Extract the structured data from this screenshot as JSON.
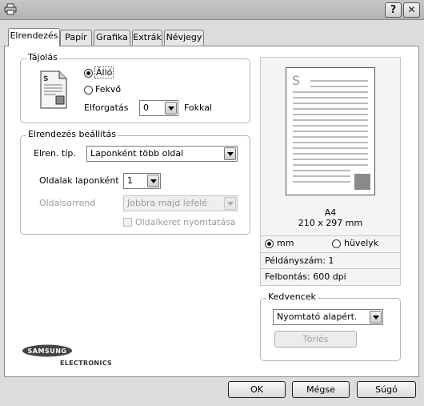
{
  "window": {
    "title": "",
    "help_button": "?",
    "close_button": "✕"
  },
  "tabs": [
    {
      "label": "Elrendezés"
    },
    {
      "label": "Papír"
    },
    {
      "label": "Grafika"
    },
    {
      "label": "Extrák"
    },
    {
      "label": "Névjegy"
    }
  ],
  "orientation": {
    "legend": "Tájolás",
    "portrait": "Álló",
    "landscape": "Fekvő",
    "rotation_label": "Elforgatás",
    "rotation_value": "0",
    "rotation_unit": "Fokkal"
  },
  "layout": {
    "legend": "Elrendezés beállítás",
    "type_label": "Elren. típ.",
    "type_value": "Laponként több oldal",
    "pages_label": "Oldalak laponként",
    "pages_value": "1",
    "order_label": "Oldalsorrend",
    "order_value": "Jobbra majd lefelé",
    "border_label": "Oldalkeret nyomtatása"
  },
  "preview": {
    "page_letter": "S",
    "paper_name": "A4",
    "paper_size": "210 x 297 mm",
    "unit_mm": "mm",
    "unit_inch": "hüvelyk",
    "copies": "Példányszám: 1",
    "resolution": "Felbontás: 600 dpi"
  },
  "favorites": {
    "legend": "Kedvencek",
    "value": "Nyomtató alapért.",
    "delete_button": "Törlés"
  },
  "brand": {
    "name": "SAMSUNG",
    "sub": "ELECTRONICS"
  },
  "buttons": {
    "ok": "OK",
    "cancel": "Mégse",
    "help": "Súgó"
  }
}
